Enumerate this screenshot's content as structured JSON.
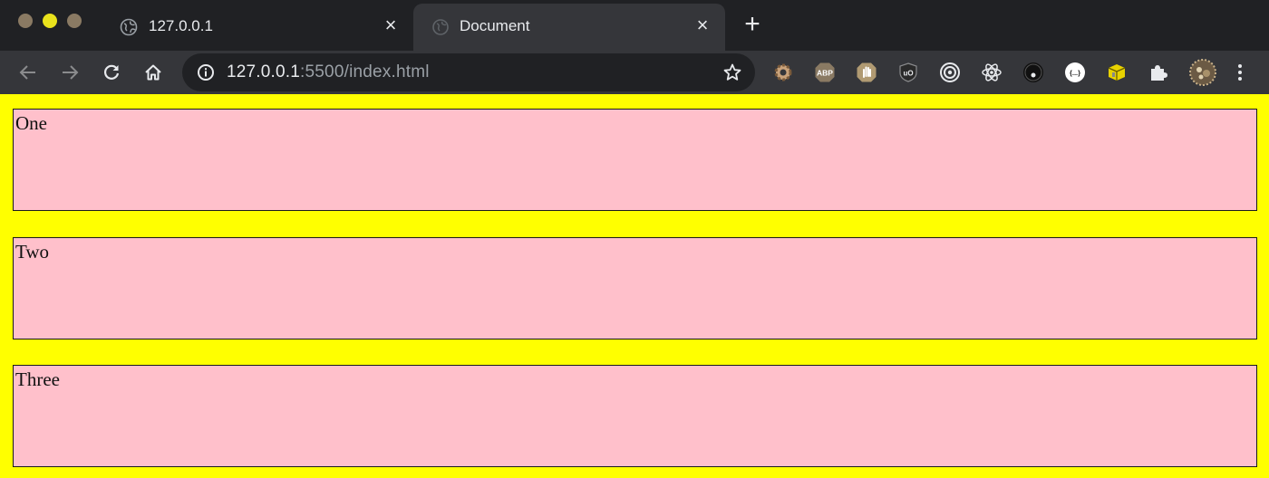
{
  "window": {
    "traffic_lights": {
      "close_color": "#8a7a63",
      "minimize_color": "#e9e21c",
      "maximize_color": "#8a7a63"
    }
  },
  "tabs": [
    {
      "title": "127.0.0.1",
      "icon": "globe-icon",
      "active": false,
      "close_label": "×"
    },
    {
      "title": "Document",
      "icon": "loading-globe-icon",
      "active": true,
      "close_label": "×"
    }
  ],
  "new_tab_label": "+",
  "toolbar": {
    "back_icon": "arrow-left-icon",
    "forward_icon": "arrow-right-icon",
    "reload_icon": "reload-icon",
    "home_icon": "home-icon"
  },
  "omnibox": {
    "info_icon": "info-icon",
    "url_host": "127.0.0.1",
    "url_rest": ":5500/index.html",
    "bookmark_icon": "star-icon"
  },
  "extensions": [
    {
      "name": "gear-extension-icon"
    },
    {
      "name": "adblock-plus-icon",
      "label": "ABP"
    },
    {
      "name": "hand-stop-extension-icon"
    },
    {
      "name": "ublock-origin-icon",
      "label": "uO"
    },
    {
      "name": "target-extension-icon"
    },
    {
      "name": "react-devtools-icon"
    },
    {
      "name": "record-extension-icon"
    },
    {
      "name": "json-viewer-icon",
      "label": "{...}"
    },
    {
      "name": "yellow-box-extension-icon"
    },
    {
      "name": "puzzle-extensions-icon"
    },
    {
      "name": "profile-avatar-icon"
    },
    {
      "name": "kebab-menu-icon"
    }
  ],
  "colors": {
    "page_background": "#ffff00",
    "box_background": "#ffc0cb",
    "box_border": "#1a1a1a",
    "chrome_dark": "#202124",
    "chrome_toolbar": "#35363a"
  },
  "page": {
    "boxes": [
      {
        "text": "One"
      },
      {
        "text": "Two"
      },
      {
        "text": "Three"
      }
    ]
  }
}
